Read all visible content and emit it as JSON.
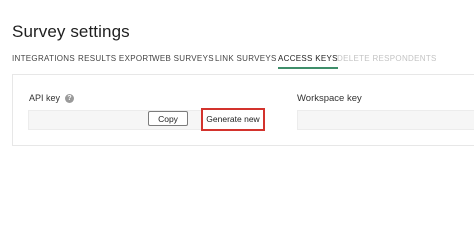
{
  "header": {
    "title": "Survey settings"
  },
  "tabs": [
    {
      "label": "INTEGRATIONS",
      "state": "normal"
    },
    {
      "label": "RESULTS EXPORT",
      "state": "normal"
    },
    {
      "label": "WEB SURVEYS",
      "state": "normal"
    },
    {
      "label": "LINK SURVEYS",
      "state": "normal"
    },
    {
      "label": "ACCESS KEYS",
      "state": "active"
    },
    {
      "label": "DELETE RESPONDENTS",
      "state": "disabled"
    }
  ],
  "api_key": {
    "label": "API key",
    "help_icon": "question-circle-icon",
    "value": "",
    "copy_label": "Copy",
    "generate_label": "Generate new"
  },
  "workspace_key": {
    "label": "Workspace key",
    "value": ""
  },
  "colors": {
    "active_tab_underline": "#3e8e6a",
    "highlight_border": "#d3332d",
    "disabled_tab": "#c4c4c4"
  }
}
